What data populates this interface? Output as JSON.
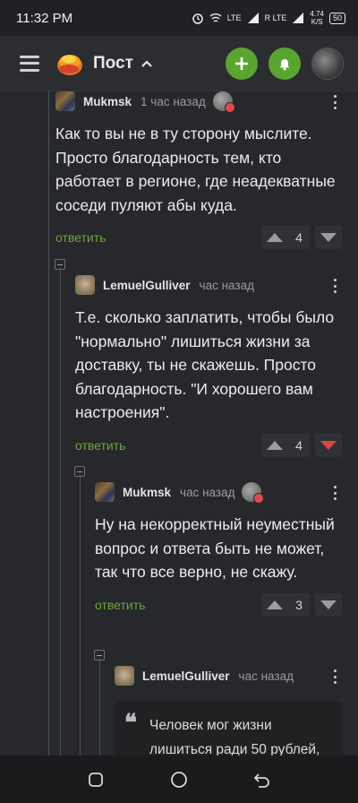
{
  "status": {
    "time": "11:32 PM",
    "net1": "LTE",
    "net2": "R LTE",
    "speed": "4.74",
    "speed_unit": "K/S",
    "battery": "50"
  },
  "header": {
    "title": "Пост",
    "add_label": "+",
    "accent": "#5aa432"
  },
  "comments": [
    {
      "user": "Mukmsk",
      "time": "1 час назад",
      "text": "Как то вы не в ту сторону мыслите. Просто благодарность тем, кто работает в регионе, где неадекватные соседи пуляют абы куда.",
      "reply": "ответить",
      "votes": "4"
    },
    {
      "user": "LemuelGulliver",
      "time": "час назад",
      "text": "Т.е. сколько заплатить, чтобы было \"нормально\" лишиться жизни за доставку, ты не скажешь. Просто благодарность. \"И хорошего вам настроения\".",
      "reply": "ответить",
      "votes": "4"
    },
    {
      "user": "Mukmsk",
      "time": "час назад",
      "text": "Ну на некорректный неуместный вопрос и ответа быть не может, так что все верно, не скажу.",
      "reply": "ответить",
      "votes": "3"
    },
    {
      "user": "LemuelGulliver",
      "time": "час назад",
      "quote": "Человек мог жизни лишиться ради 50 рублей,"
    }
  ],
  "colors": {
    "background": "#26282b",
    "reply": "#6da53a",
    "downvote_active": "#d9473f"
  }
}
